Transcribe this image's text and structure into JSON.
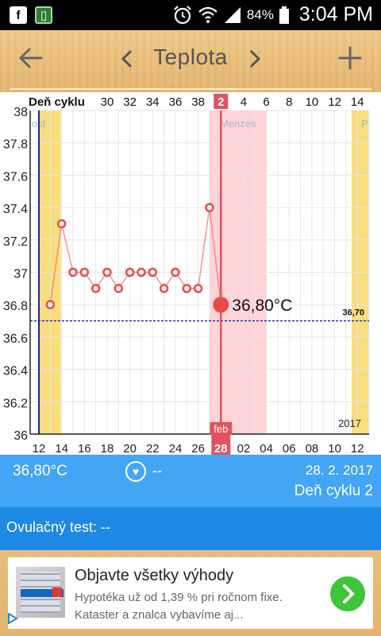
{
  "status_bar": {
    "battery_percent": "84%",
    "time": "3:04 PM"
  },
  "header": {
    "title": "Teplota"
  },
  "chart_data": {
    "type": "line",
    "title": "",
    "top_axis_label": "Deň cyklu",
    "cycle_day_ticks": [
      "30",
      "32",
      "34",
      "36",
      "38",
      "2",
      "4",
      "6",
      "8",
      "10",
      "12",
      "14"
    ],
    "current_cycle_day": "2",
    "date_ticks": [
      "12",
      "14",
      "16",
      "18",
      "20",
      "22",
      "24",
      "26",
      "28",
      "02",
      "04",
      "06",
      "08",
      "10",
      "12"
    ],
    "current_month_label": "feb",
    "current_date_label": "28",
    "year_label": "2017",
    "ylim": [
      36,
      38
    ],
    "y_ticks": [
      "36",
      "36.2",
      "36.4",
      "36.6",
      "36.8",
      "37",
      "37.2",
      "37.4",
      "37.6",
      "37.8",
      "38"
    ],
    "x": [
      13,
      14,
      15,
      16,
      17,
      18,
      19,
      20,
      21,
      22,
      23,
      24,
      25,
      26,
      27,
      28
    ],
    "x_unit": "day of Feb 2017",
    "series": [
      {
        "values": [
          36.8,
          37.3,
          37.0,
          37.0,
          36.9,
          37.0,
          36.9,
          37.0,
          37.0,
          37.0,
          36.9,
          37.0,
          36.9,
          36.9,
          37.4,
          36.8
        ]
      }
    ],
    "coverline_value": 36.7,
    "coverline_label": "36,70",
    "selected_value_label": "36,80°C",
    "phase_labels": {
      "left": "ost",
      "menses": "Menzes",
      "right": "P"
    },
    "colors": {
      "series": "#f07272",
      "points": "#ec4848",
      "menses": "#ffd4d7",
      "fertile": "#f9de7d",
      "current_day": "#e05360",
      "coverline": "#1f1fb3"
    }
  },
  "info": {
    "temperature": "36,80°C",
    "heart_value": "--",
    "date": "28. 2. 2017",
    "cycle_day": "Deň cyklu 2"
  },
  "ovulation": {
    "label": "Ovulačný test: --"
  },
  "ad": {
    "title": "Objavte všetky výhody",
    "line1": "Hypotéka už od 1,39 % pri ročnom fixe.",
    "line2": "Kataster a znalca vybavíme aj..."
  }
}
